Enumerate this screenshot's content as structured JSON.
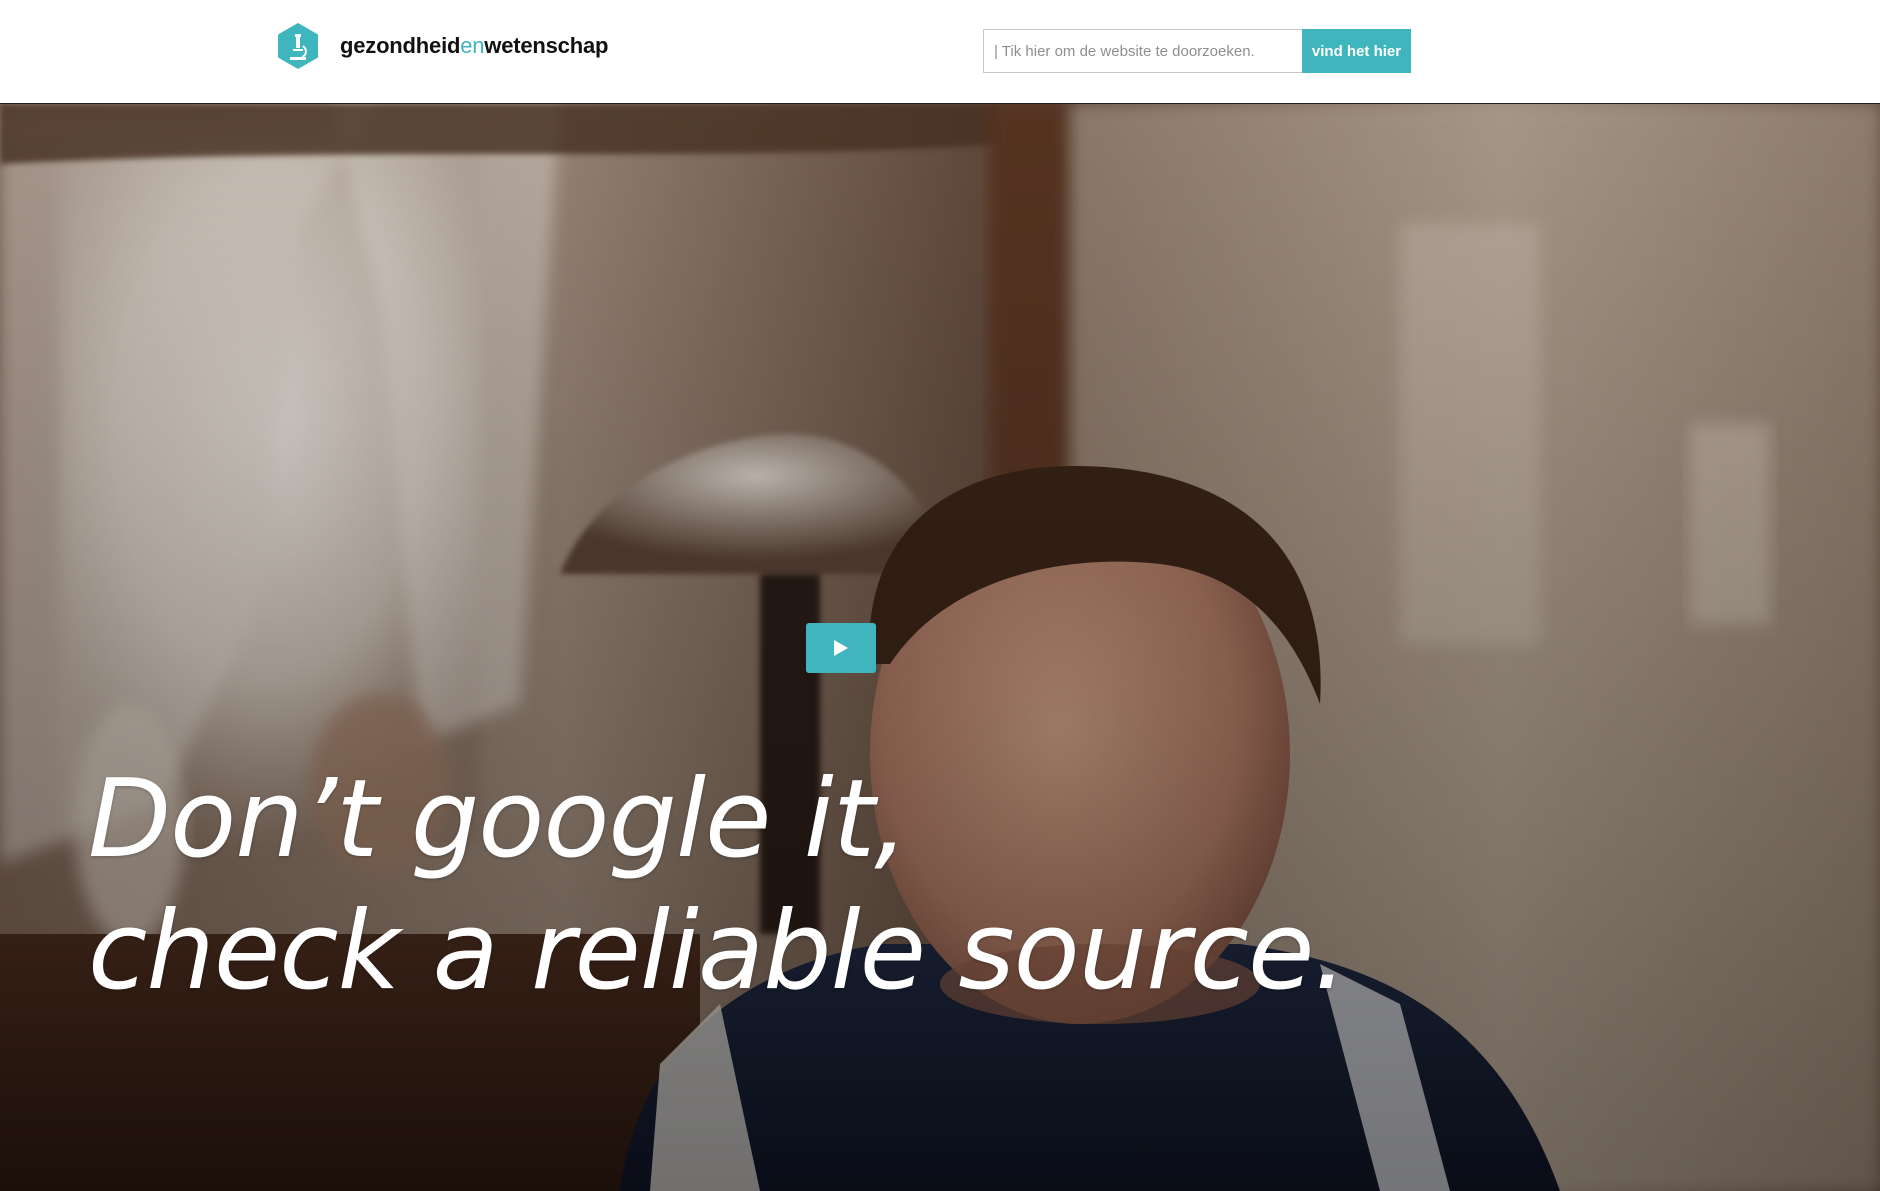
{
  "header": {
    "brand": {
      "part1": "gezondheid",
      "part2": "en",
      "part3": "wetenschap",
      "logo_icon": "microscope-icon"
    },
    "search": {
      "placeholder": "| Tik hier om de website te doorzoeken.",
      "button_label": "vind het hier"
    }
  },
  "hero": {
    "tagline_line1": "Don’t google it,",
    "tagline_line2": "check a reliable source.",
    "play_icon": "play-icon"
  },
  "colors": {
    "accent": "#3fb5be",
    "text": "#111111",
    "tagline": "#ffffff"
  }
}
